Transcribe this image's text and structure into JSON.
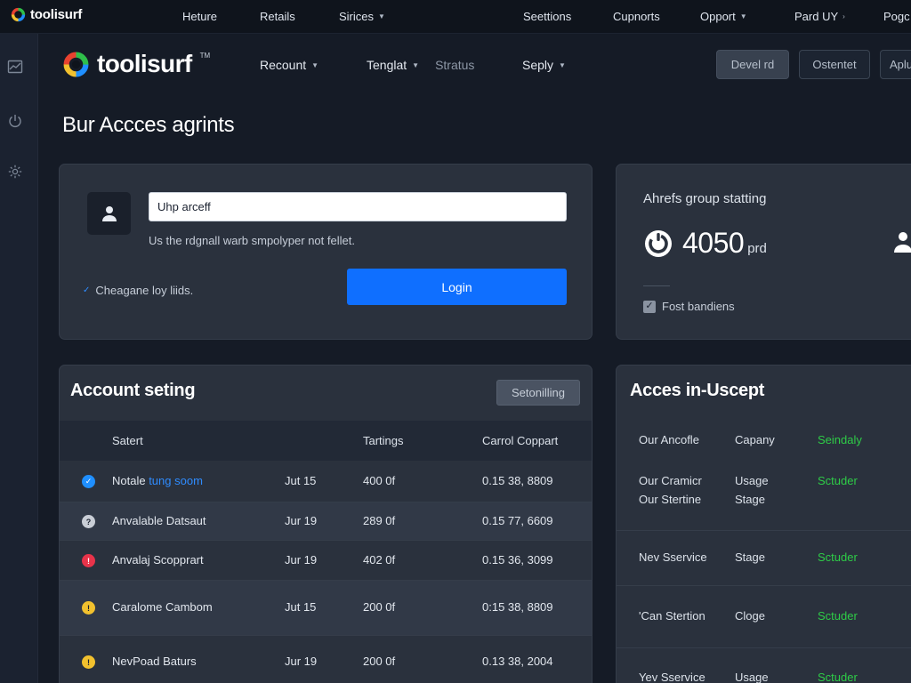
{
  "brand": {
    "name": "toolisurf",
    "mark": "TM",
    "ring_colors": [
      "#1f8fff",
      "#f2c12e",
      "#e8422f",
      "#2fbf4a"
    ]
  },
  "top_nav": [
    {
      "label": "Heture",
      "chevron": false
    },
    {
      "label": "Retails",
      "chevron": false
    },
    {
      "label": "Sirices",
      "chevron": true
    },
    {
      "label": "Seettions",
      "chevron": false
    },
    {
      "label": "Cupnorts",
      "chevron": false
    },
    {
      "label": "Opport",
      "chevron": true
    },
    {
      "label": "Pard UY",
      "chevron": true
    },
    {
      "label": "Pogc",
      "chevron": false
    }
  ],
  "rail_icons": [
    "chart-icon",
    "power-icon",
    "gear-icon"
  ],
  "sub_nav": {
    "recount": "Recount",
    "tenglat": "Tenglat",
    "stratus": "Stratus",
    "seply": "Seply"
  },
  "header_buttons": {
    "devel": "Devel rd",
    "ostentet": "Ostentet",
    "aplu": "Aplu"
  },
  "page_title": "Bur Accces agrints",
  "login": {
    "input_value": "Uhp arceff",
    "hint": "Us the rdgnall warb smpolyper not fellet.",
    "check_label": "Cheagane loy liids.",
    "button_label": "Login"
  },
  "stats": {
    "title": "Ahrefs group statting",
    "value": "4050",
    "unit": "prd",
    "check_label": "Fost bandiens",
    "checked": true
  },
  "account": {
    "title": "Account seting",
    "button_label": "Setonilling",
    "columns": [
      "Satert",
      "Tartings",
      "Carrol Coppart"
    ],
    "rows": [
      {
        "icon": "check-circle-icon",
        "icon_color": "#1f8fff",
        "glyph": "✓",
        "name_prefix": "Notale",
        "name_highlight": "tung soom",
        "date": "Jut 15",
        "amount": "400 0f",
        "code": "0.15 38, 8809"
      },
      {
        "icon": "help-circle-icon",
        "icon_color": "#c9ced6",
        "glyph": "?",
        "name_prefix": "Anvalable Datsaut",
        "name_highlight": "",
        "date": "Jur 19",
        "amount": "289 0f",
        "code": "0.15 77, 6609"
      },
      {
        "icon": "alert-circle-icon",
        "icon_color": "#e8334a",
        "glyph": "!",
        "name_prefix": "Anvalaj Scopprart",
        "name_highlight": "",
        "date": "Jur 19",
        "amount": "402 0f",
        "code": "0.15 36, 3099"
      },
      {
        "icon": "warning-circle-icon",
        "icon_color": "#f2c12e",
        "glyph": "!",
        "name_prefix": "Caralome Cambom",
        "name_highlight": "",
        "date": "Jut 15",
        "amount": "200 0f",
        "code": "0:15 38, 8809"
      },
      {
        "icon": "warning-circle-icon",
        "icon_color": "#f2c12e",
        "glyph": "!",
        "name_prefix": "NevPoad Baturs",
        "name_highlight": "",
        "date": "Jur 19",
        "amount": "200 0f",
        "code": "0.13 38, 2004"
      }
    ]
  },
  "access": {
    "title": "Acces in-Uscept",
    "header": {
      "name": "Our Ancofle",
      "type": "Capany",
      "status": "Seindaly"
    },
    "rows": [
      {
        "name": "Our Cramicr\nOur Stertine",
        "type": "Usage\nStage",
        "status": "Sctuder"
      },
      {
        "name": "Nev Sservice",
        "type": "Stage",
        "status": "Sctuder"
      },
      {
        "name": "'Can Stertion",
        "type": "Cloge",
        "status": "Sctuder"
      },
      {
        "name": "Yev Sservice",
        "type": "Usage",
        "status": "Sctuder"
      }
    ]
  }
}
